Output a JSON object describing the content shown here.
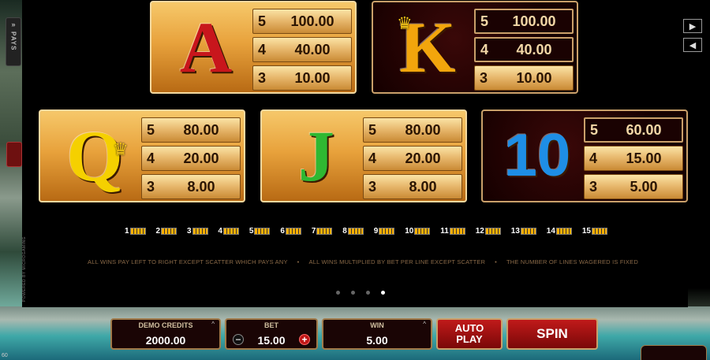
{
  "sidebar": {
    "pays_arrows": "»",
    "pays_label": "PAYS",
    "powered_by": "POWERED BY MICROGAMING",
    "corner_number": "60"
  },
  "nav": {
    "next": "▶",
    "prev": "◀"
  },
  "cards": [
    {
      "symbol": "A",
      "color": "#c8161c",
      "style": "gold",
      "pays": [
        {
          "count": "5",
          "amount": "100.00",
          "highlight": false
        },
        {
          "count": "4",
          "amount": "40.00",
          "highlight": false
        },
        {
          "count": "3",
          "amount": "10.00",
          "highlight": false
        }
      ]
    },
    {
      "symbol": "K",
      "color": "#f2a50c",
      "style": "dark",
      "crown": "♛",
      "pays": [
        {
          "count": "5",
          "amount": "100.00",
          "highlight": true
        },
        {
          "count": "4",
          "amount": "40.00",
          "highlight": true
        },
        {
          "count": "3",
          "amount": "10.00",
          "highlight": false
        }
      ]
    },
    {
      "symbol": "Q",
      "color": "#f5d000",
      "style": "gold",
      "crown": "♛",
      "pays": [
        {
          "count": "5",
          "amount": "80.00",
          "highlight": false
        },
        {
          "count": "4",
          "amount": "20.00",
          "highlight": false
        },
        {
          "count": "3",
          "amount": "8.00",
          "highlight": false
        }
      ]
    },
    {
      "symbol": "J",
      "color": "#2fb832",
      "style": "gold",
      "pays": [
        {
          "count": "5",
          "amount": "80.00",
          "highlight": false
        },
        {
          "count": "4",
          "amount": "20.00",
          "highlight": false
        },
        {
          "count": "3",
          "amount": "8.00",
          "highlight": false
        }
      ]
    },
    {
      "symbol": "10",
      "color": "#1e8ee6",
      "style": "dark",
      "pays": [
        {
          "count": "5",
          "amount": "60.00",
          "highlight": true
        },
        {
          "count": "4",
          "amount": "15.00",
          "highlight": false
        },
        {
          "count": "3",
          "amount": "5.00",
          "highlight": false
        }
      ]
    }
  ],
  "paylines": [
    "1",
    "2",
    "3",
    "4",
    "5",
    "6",
    "7",
    "8",
    "9",
    "10",
    "11",
    "12",
    "13",
    "14",
    "15"
  ],
  "info": [
    "ALL WINS PAY LEFT TO RIGHT EXCEPT SCATTER WHICH PAYS ANY",
    "ALL WINS MULTIPLIED BY BET PER LINE EXCEPT SCATTER",
    "THE NUMBER OF LINES WAGERED IS FIXED"
  ],
  "info_separator": "•",
  "page_dots": {
    "count": 4,
    "active_index": 3
  },
  "hud": {
    "credits_label": "DEMO CREDITS",
    "credits_value": "2000.00",
    "caret": "^",
    "bet_label": "BET",
    "bet_value": "15.00",
    "bet_minus": "−",
    "bet_plus": "+",
    "win_label": "WIN",
    "win_value": "5.00",
    "autoplay_label": "AUTO PLAY",
    "spin_label": "SPIN"
  }
}
